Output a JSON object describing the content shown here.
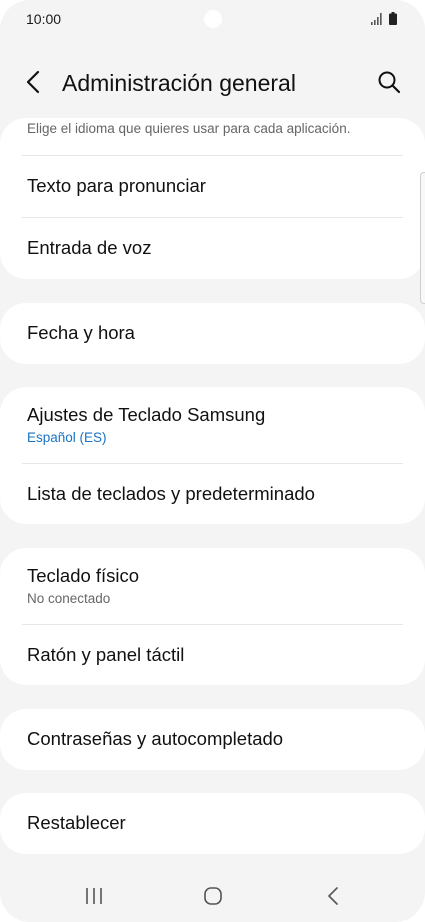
{
  "status": {
    "time": "10:00"
  },
  "header": {
    "title": "Administración general"
  },
  "cards": {
    "lang": {
      "cut_subtitle": "Elige el idioma que quieres usar para cada aplicación.",
      "tts": "Texto para pronunciar",
      "voice": "Entrada de voz"
    },
    "date": {
      "label": "Fecha y hora"
    },
    "keyboard": {
      "samsung": "Ajustes de Teclado Samsung",
      "samsung_sub": "Español (ES)",
      "list": "Lista de teclados y predeterminado"
    },
    "physical": {
      "label": "Teclado físico",
      "sub": "No conectado",
      "mouse": "Ratón y panel táctil"
    },
    "passwords": {
      "label": "Contraseñas y autocompletado"
    },
    "reset": {
      "label": "Restablecer"
    }
  },
  "icons": {
    "back": "back-arrow-icon",
    "search": "search-icon",
    "nav_recents": "recents-icon",
    "nav_home": "home-icon",
    "nav_back": "back-icon"
  },
  "colors": {
    "accent": "#1a73c4",
    "background": "#f4f4f4",
    "card": "#ffffff"
  }
}
